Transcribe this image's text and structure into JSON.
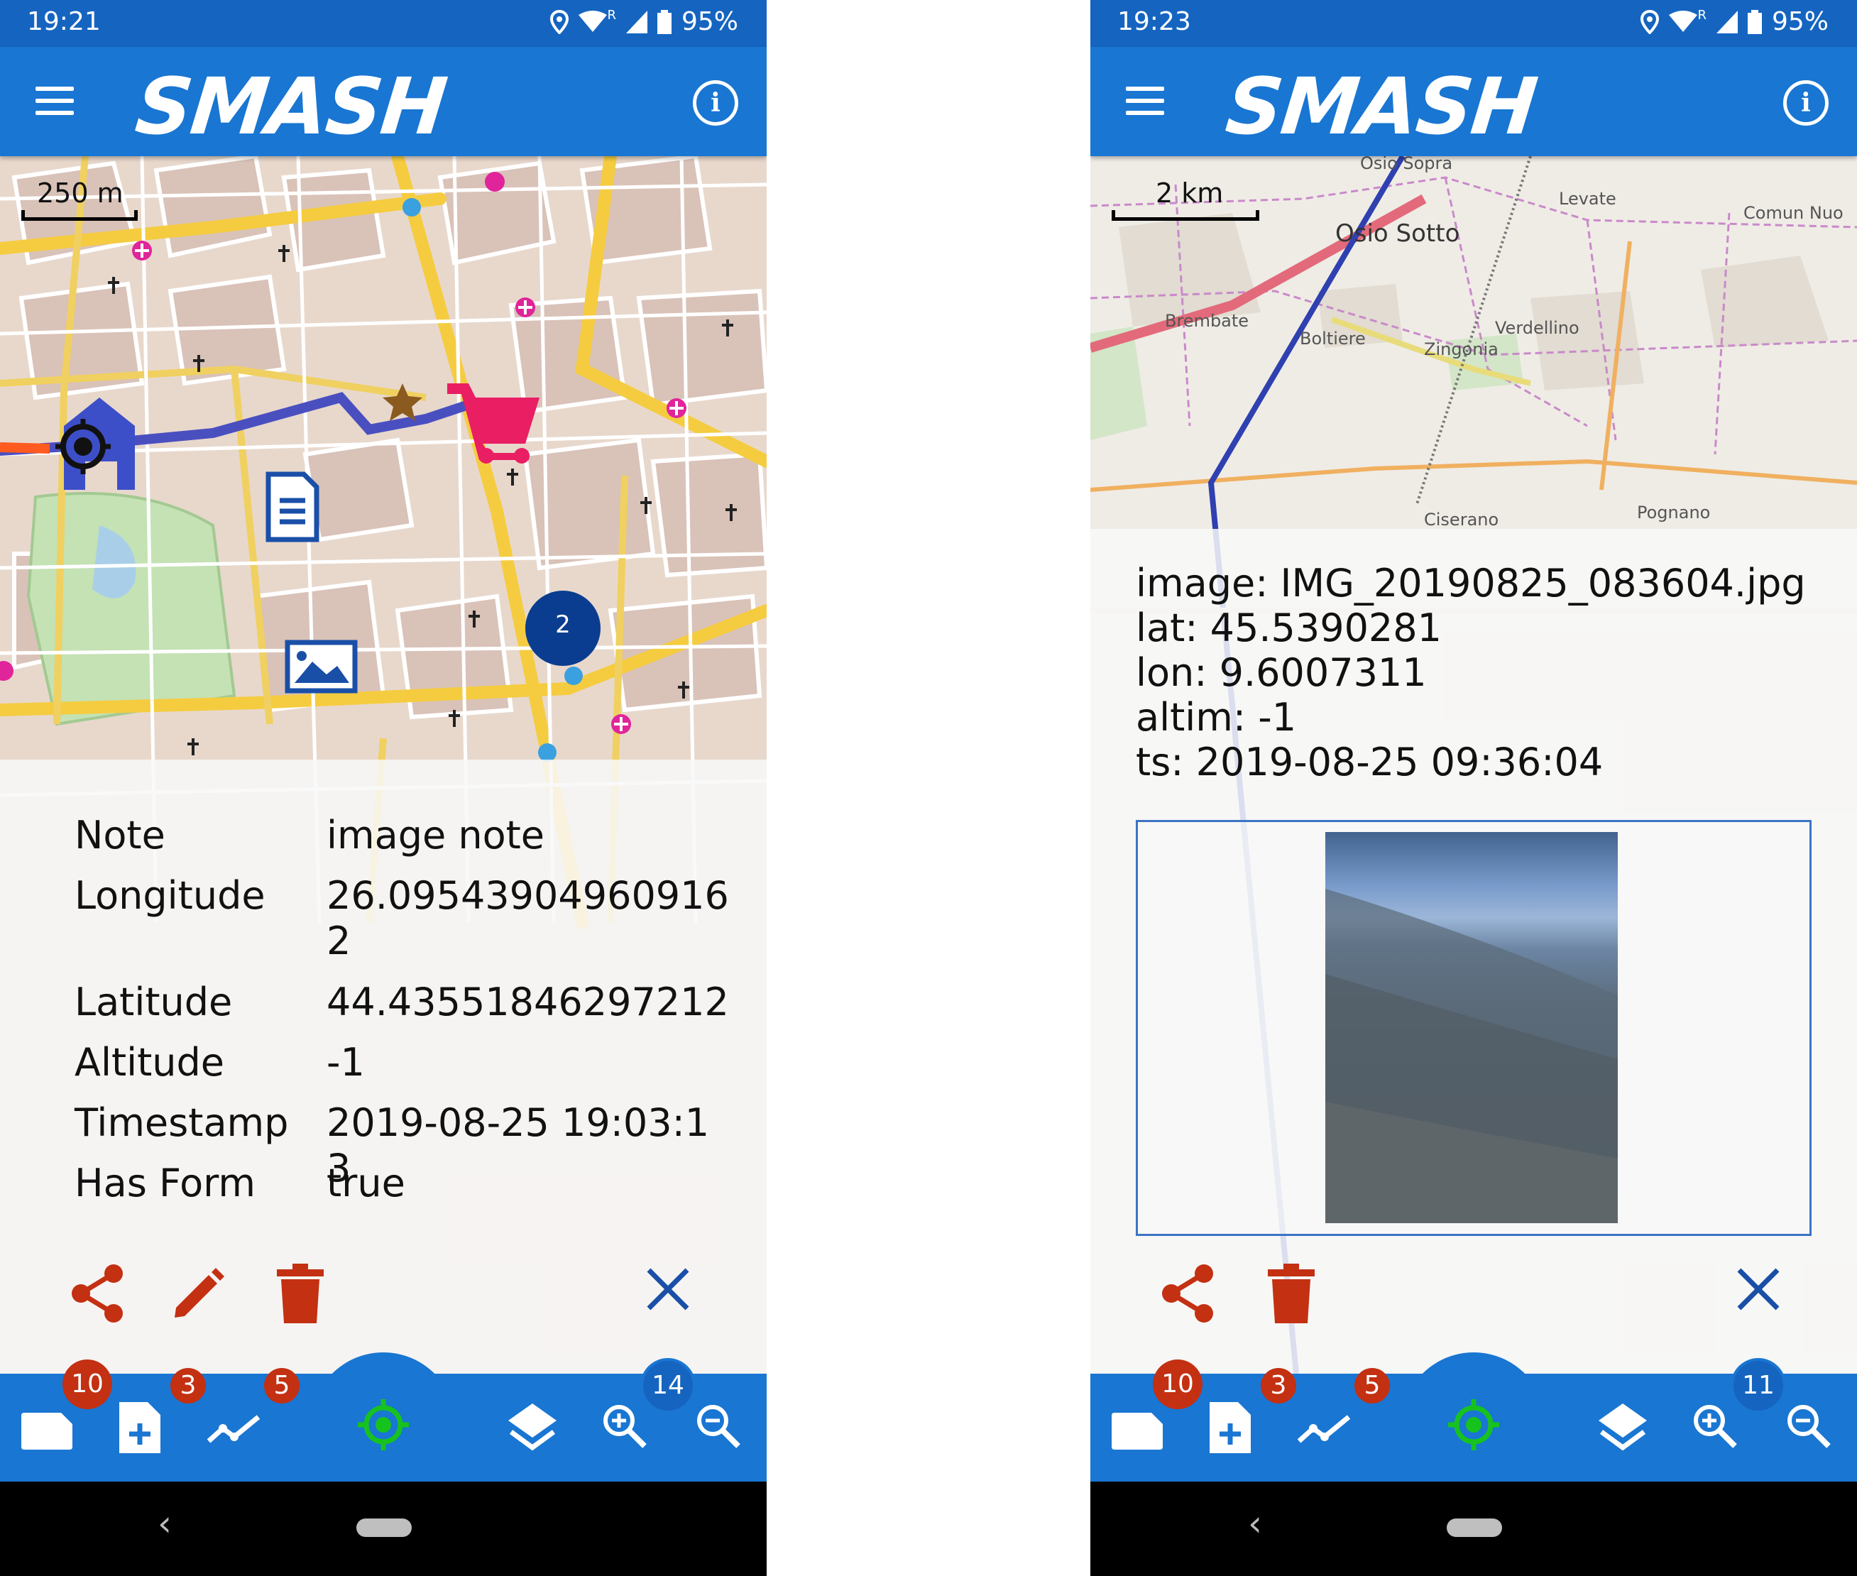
{
  "left": {
    "status": {
      "time": "19:21",
      "roaming": "R",
      "battery": "95%"
    },
    "app_title": "SMASH",
    "scale_label": "250 m",
    "cluster_count": "2",
    "fields": [
      {
        "key": "Note",
        "value": "image note"
      },
      {
        "key": "Longitude",
        "value": "26.095439049609162"
      },
      {
        "key": "Latitude",
        "value": "44.43551846297212"
      },
      {
        "key": "Altitude",
        "value": "-1"
      },
      {
        "key": "Timestamp",
        "value": "2019-08-25 19:03:13"
      },
      {
        "key": "Has Form",
        "value": "true"
      }
    ],
    "actions": {
      "share": "share-icon",
      "edit": "pencil-icon",
      "delete": "trash-icon",
      "close": "close-icon"
    },
    "badges": {
      "notes": "10",
      "form_notes": "3",
      "logs": "5",
      "zoom": "14"
    },
    "colors": {
      "appbar": "#1976d2",
      "action_red": "#c33012",
      "badge_red": "#c33012",
      "gps_green": "#17c21f"
    }
  },
  "right": {
    "status": {
      "time": "19:23",
      "roaming": "R",
      "battery": "95%"
    },
    "app_title": "SMASH",
    "scale_label": "2 km",
    "map_labels": [
      "Osio Sopra",
      "Levate",
      "Comun Nuo",
      "Osio Sotto",
      "Brembate",
      "Boltiere",
      "Verdellino",
      "Zingonia",
      "Ciserano",
      "Pognano"
    ],
    "image_info": [
      "image: IMG_20190825_083604.jpg",
      "lat: 45.5390281",
      "lon: 9.6007311",
      "altim: -1",
      "ts: 2019-08-25 09:36:04"
    ],
    "actions": {
      "share": "share-icon",
      "delete": "trash-icon",
      "close": "close-icon"
    },
    "badges": {
      "notes": "10",
      "form_notes": "3",
      "logs": "5",
      "zoom": "11"
    }
  }
}
